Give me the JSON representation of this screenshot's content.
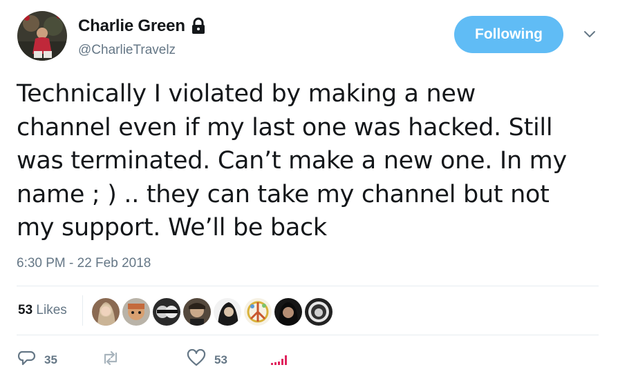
{
  "user": {
    "display_name": "Charlie Green",
    "handle": "@CharlieTravelz",
    "protected_icon": "lock-icon",
    "avatar_icon": "avatar"
  },
  "header": {
    "follow_button_label": "Following",
    "menu_icon": "chevron-down-icon"
  },
  "tweet": {
    "lines": [
      "Technically I violated by making a new",
      "channel even if my last one was hacked. Still",
      "was terminated. Can’t make a new one. In my",
      "name ; ) .. they can take my channel but not",
      "my support. We’ll be back"
    ],
    "timestamp": "6:30 PM - 22 Feb 2018"
  },
  "stats": {
    "likes_count": "53",
    "likes_label": "Likes",
    "likers": [
      "liker-avatar-1",
      "liker-avatar-2",
      "liker-avatar-3",
      "liker-avatar-4",
      "liker-avatar-5",
      "liker-avatar-6",
      "liker-avatar-7",
      "liker-avatar-8"
    ]
  },
  "actions": {
    "reply_count": "35",
    "retweet_count": "",
    "like_count": "53",
    "icons": [
      "reply-icon",
      "retweet-icon",
      "heart-icon",
      "analytics-icon"
    ]
  },
  "colors": {
    "accent": "#1da1f2",
    "text": "#14171a",
    "muted": "#657786",
    "divider": "#e6ecf0"
  }
}
